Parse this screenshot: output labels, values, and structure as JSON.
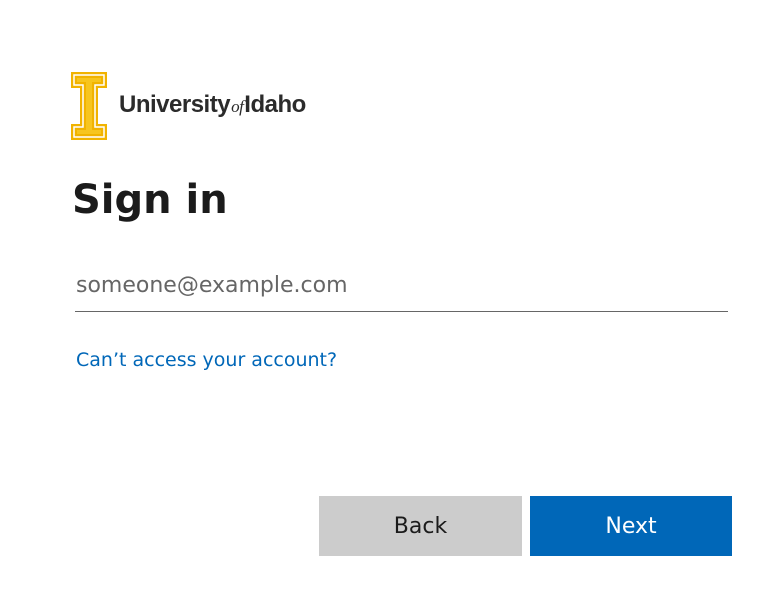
{
  "logo": {
    "icon": "block-i-icon",
    "part1": "University",
    "part2": "of",
    "part3": "Idaho",
    "colors": {
      "gold": "#f1b300",
      "dark": "#2b2b2b"
    }
  },
  "title": "Sign in",
  "email": {
    "placeholder": "someone@example.com",
    "value": ""
  },
  "help_link": "Can’t access your account?",
  "buttons": {
    "back": "Back",
    "next": "Next"
  },
  "colors": {
    "accent": "#0067b8",
    "secondary_button": "#cccccc"
  }
}
